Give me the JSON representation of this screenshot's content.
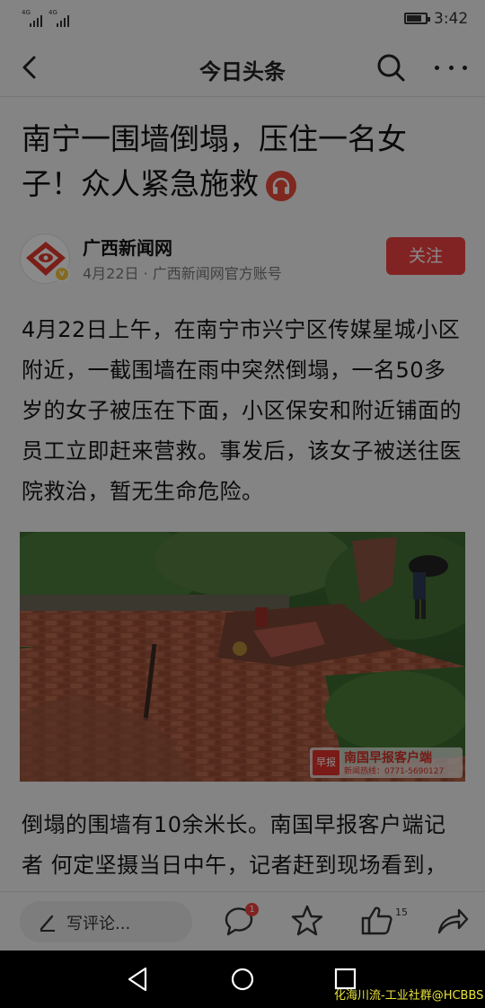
{
  "status_bar": {
    "signal_1": "4G",
    "signal_2": "4G",
    "time": "3:42",
    "battery_level": 0.8
  },
  "header": {
    "title": "今日头条",
    "back_icon": "chevron-left-icon",
    "search_icon": "search-icon",
    "more_icon": "more-dots-icon"
  },
  "article": {
    "title": "南宁一围墙倒塌，压住一名女子！众人紧急施救",
    "author": {
      "name": "广西新闻网",
      "meta": "4月22日 · 广西新闻网官方账号",
      "follow_label": "关注",
      "verified_mark": "v"
    },
    "paragraph_1": "4月22日上午，在南宁市兴宁区传媒星城小区附近，一截围墙在雨中突然倒塌，一名50多岁的女子被压在下面，小区保安和附近铺面的员工立即赶来营救。事发后，该女子被送往医院救治，暂无生命危险。",
    "image": {
      "watermark_logo": "早报",
      "watermark_text": "南国早报客户端",
      "watermark_phone": "新闻热线：0771-5690127"
    },
    "paragraph_2": "倒塌的围墙有10余米长。南国早报客户端记者 何定坚摄当日中午，记者赶到现场看到，"
  },
  "bottom_bar": {
    "comment_placeholder": "写评论...",
    "comment_badge": "1",
    "like_count": "15"
  },
  "footer": {
    "watermark": "化海川流-工业社群@HCBBS"
  },
  "colors": {
    "accent_red": "#f04142",
    "background": "#f4f4f4"
  }
}
